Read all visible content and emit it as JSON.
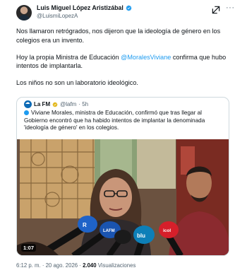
{
  "author": {
    "display_name": "Luis Miguel López Aristizábal",
    "handle": "@LuismiLopezA"
  },
  "icons": {
    "verified": "verified-badge-icon",
    "follow": "grok-icon",
    "more": "more-icon"
  },
  "tweet": {
    "line1": "Nos llamaron retrógrados, nos dijeron que la ideología de género en los colegios era un invento.",
    "line2_before": "Hoy la propia Ministra de Educación ",
    "line2_mention": "@MoralesViviane",
    "line2_after": " confirma que hubo intentos de implantarla.",
    "line3": "Los niños no son un laboratorio ideológico."
  },
  "quote": {
    "name": "La FM",
    "handle": "@lafm",
    "time": "· 5h",
    "text": "Viviane Morales, ministra de Educación, confirmó que tras llegar al Gobierno encontró que ha habido intentos de implantar la denominada 'ideología de género' en los colegios.",
    "video_duration": "1:07"
  },
  "footer": {
    "timestamp": "6:12 p. m. · 20 ago. 2026 · ",
    "views_count": "2.040",
    "views_label": " Visualizaciones"
  },
  "colors": {
    "accent": "#1d9bf0",
    "text": "#0f1419",
    "muted": "#536471",
    "border": "#cfd9de"
  }
}
